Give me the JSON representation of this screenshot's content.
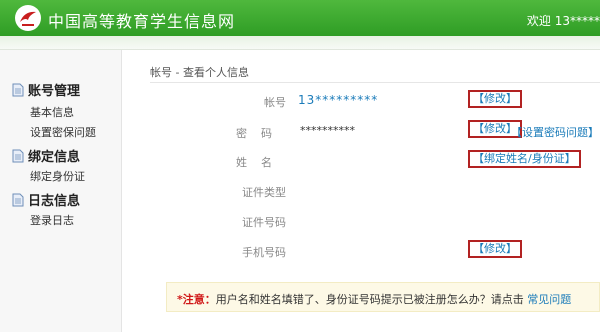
{
  "header": {
    "site_title": "中国高等教育学生信息网",
    "welcome": "欢迎 13*****"
  },
  "sidebar": {
    "sections": [
      {
        "title": "账号管理",
        "items": [
          "基本信息",
          "设置密保问题"
        ]
      },
      {
        "title": "绑定信息",
        "items": [
          "绑定身份证"
        ]
      },
      {
        "title": "日志信息",
        "items": [
          "登录日志"
        ]
      }
    ]
  },
  "main": {
    "breadcrumb": "帐号 - 查看个人信息",
    "fields": {
      "account": {
        "label": "帐号",
        "value": "13*********",
        "action": "【修改】"
      },
      "password": {
        "label": "密码",
        "value": "**********",
        "action": "【修改】",
        "extra_link": "【设置密码问题】"
      },
      "name": {
        "label": "姓名",
        "action": "【绑定姓名/身份证】"
      },
      "id_type": {
        "label": "证件类型"
      },
      "id_number": {
        "label": "证件号码"
      },
      "phone": {
        "label": "手机号码",
        "action": "【修改】"
      }
    },
    "notice": {
      "prefix": "*注意：",
      "text": "用户名和姓名填错了、身份证号码提示已被注册怎么办？请点击 ",
      "link": "常见问题"
    }
  },
  "colors": {
    "header_green": "#3aa82e",
    "link_blue": "#1a7bb9",
    "button_border": "#b22222",
    "notice_bg": "#fdf9e6",
    "warning_red": "#d01818"
  }
}
